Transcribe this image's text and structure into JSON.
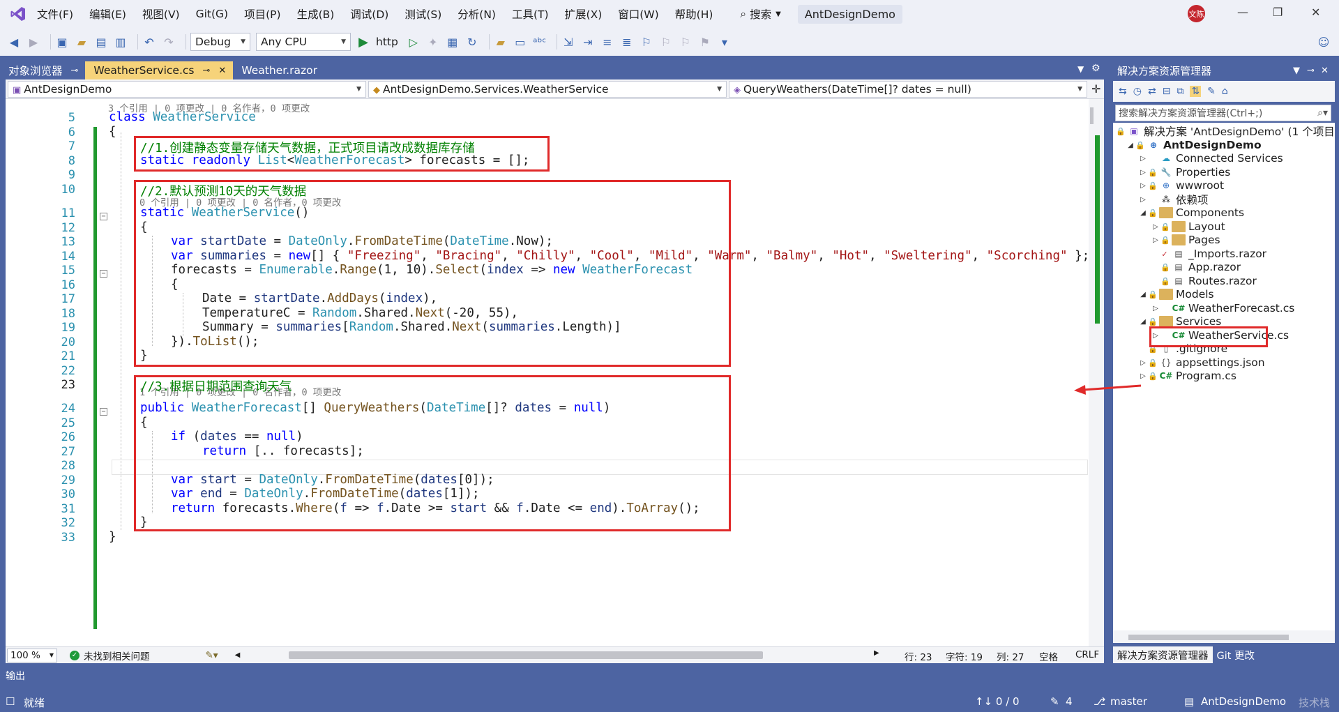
{
  "menu": [
    "文件(F)",
    "编辑(E)",
    "视图(V)",
    "Git(G)",
    "项目(P)",
    "生成(B)",
    "调试(D)",
    "测试(S)",
    "分析(N)",
    "工具(T)",
    "扩展(X)",
    "窗口(W)",
    "帮助(H)"
  ],
  "search_label": "搜索",
  "project_badge": "AntDesignDemo",
  "avatar_text": "文陈",
  "toolbar": {
    "config": "Debug",
    "platform": "Any CPU",
    "run_label": "http"
  },
  "tabs": [
    {
      "label": "对象浏览器"
    },
    {
      "label": "WeatherService.cs"
    },
    {
      "label": "Weather.razor"
    }
  ],
  "navbar": {
    "project": "AntDesignDemo",
    "type": "AntDesignDemo.Services.WeatherService",
    "member": "QueryWeathers(DateTime[]? dates = null)"
  },
  "lens": {
    "class": "3 个引用 | 0 项更改 | 0 名作者，0 项更改",
    "ctor": "0 个引用 | 0 项更改 | 0 名作者，0 项更改",
    "method": "1 个引用 | 0 项更改 | 0 名作者，0 项更改"
  },
  "editor_status": {
    "zoom": "100 %",
    "issues": "未找到相关问题",
    "line": "行: 23",
    "char": "字符: 19",
    "col": "列: 27",
    "ws": "空格",
    "eol": "CRLF"
  },
  "solution": {
    "title": "解决方案资源管理器",
    "search_placeholder": "搜索解决方案资源管理器(Ctrl+;)",
    "root": "解决方案 'AntDesignDemo' (1 个项目,",
    "items": [
      {
        "label": "AntDesignDemo"
      },
      {
        "label": "Connected Services"
      },
      {
        "label": "Properties"
      },
      {
        "label": "wwwroot"
      },
      {
        "label": "依赖项"
      },
      {
        "label": "Components"
      },
      {
        "label": "Layout"
      },
      {
        "label": "Pages"
      },
      {
        "label": "_Imports.razor"
      },
      {
        "label": "App.razor"
      },
      {
        "label": "Routes.razor"
      },
      {
        "label": "Models"
      },
      {
        "label": "WeatherForecast.cs"
      },
      {
        "label": "Services"
      },
      {
        "label": "WeatherService.cs"
      },
      {
        "label": ".gitignore"
      },
      {
        "label": "appsettings.json"
      },
      {
        "label": "Program.cs"
      }
    ],
    "tabs": [
      "解决方案资源管理器",
      "Git 更改"
    ]
  },
  "output_label": "输出",
  "status": {
    "ready": "就绪",
    "sync": "↑↓ 0 / 0",
    "edits": "4",
    "branch": "master",
    "repo": "AntDesignDemo",
    "watermark": "技术栈"
  },
  "colors": {
    "accent": "#4d64a2",
    "active_tab": "#f6d37a",
    "annotation": "#e02a2a",
    "changes": "#20992e"
  }
}
